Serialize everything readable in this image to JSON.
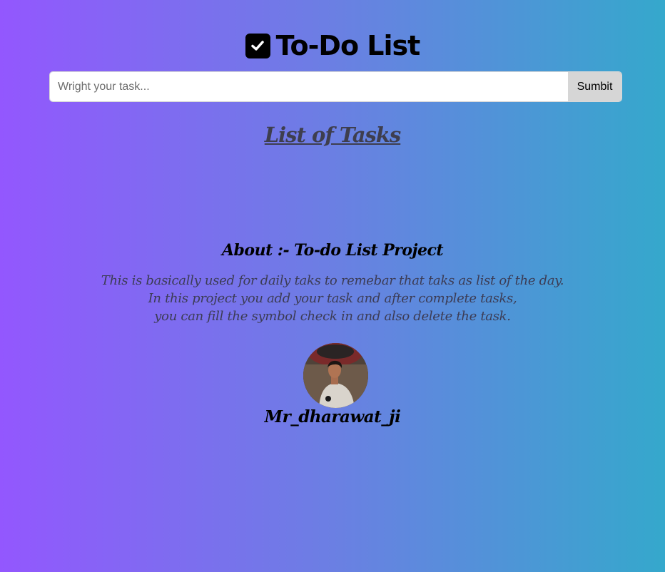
{
  "header": {
    "icon": "check-square-icon",
    "title": "To-Do List"
  },
  "form": {
    "placeholder": "Wright your task...",
    "value": "",
    "submit_label": "Sumbit"
  },
  "list": {
    "heading": "List of Tasks",
    "items": []
  },
  "about": {
    "title": "About :- To-do List Project",
    "lines": [
      "This is basically used for daily taks to remebar that taks as list of the day.",
      "In this project you add your task and after complete tasks,",
      "you can fill the symbol check in and also delete the task."
    ]
  },
  "author": {
    "avatar": "author-avatar-photo",
    "name": "Mr_dharawat_ji"
  },
  "colors": {
    "gradient_start": "#9357fe",
    "gradient_end": "#35a8cc",
    "submit_bg": "#d6d6d6"
  }
}
